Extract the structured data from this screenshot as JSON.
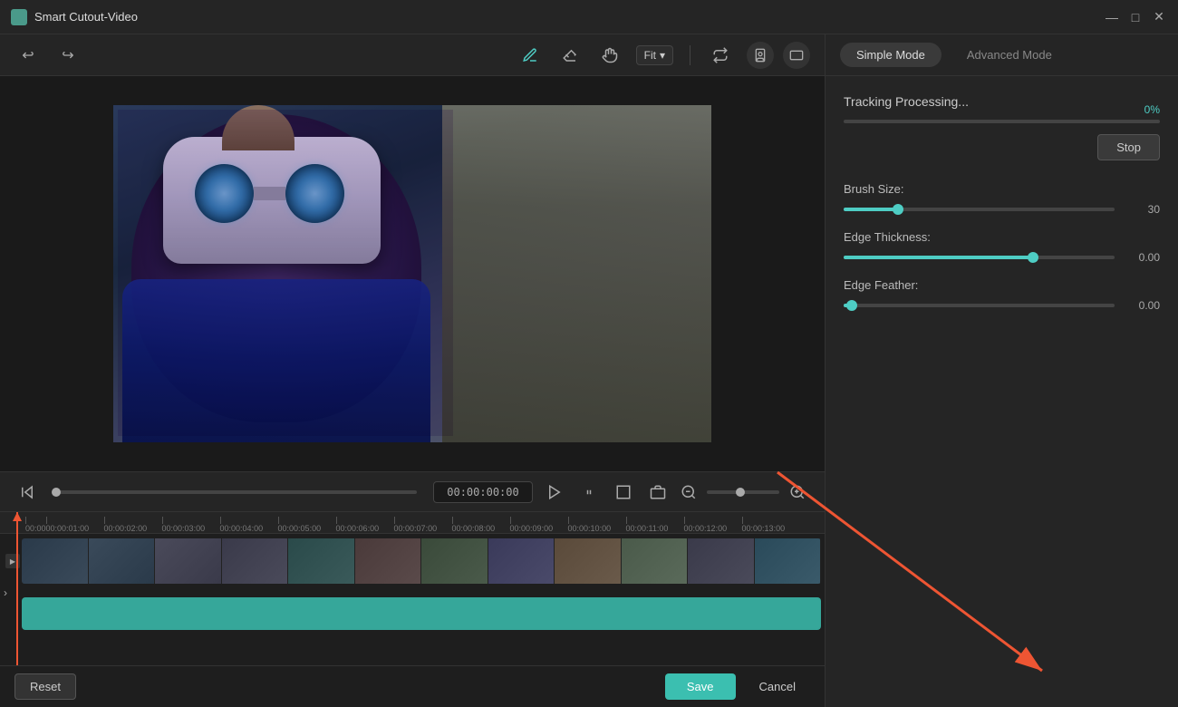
{
  "app": {
    "title": "Smart Cutout-Video"
  },
  "window_controls": {
    "minimize": "—",
    "maximize": "□",
    "close": "✕"
  },
  "toolbar": {
    "undo_label": "↩",
    "redo_label": "↪",
    "draw_label": "✏",
    "erase_label": "◯",
    "hand_label": "✋",
    "fit_label": "Fit",
    "fit_dropdown": "▾",
    "swap_label": "⇄",
    "portrait_icon": "👤",
    "landscape_icon": "⬚"
  },
  "playback": {
    "time": "00:00:00:00",
    "prev_frame": "⏮",
    "play": "▶",
    "pause": "⏸",
    "stop_square": "⏹"
  },
  "timeline": {
    "ruler_marks": [
      "00:00",
      "00:00:01:00",
      "00:00:02:00",
      "00:00:03:00",
      "00:00:04:00",
      "00:00:05:00",
      "00:00:06:00",
      "00:00:07:00",
      "00:00:08:00",
      "00:00:09:00",
      "00:00:10:00",
      "00:00:11:00",
      "00:00:12:00",
      "00:00:13:00"
    ]
  },
  "right_panel": {
    "mode_tabs": [
      "Simple Mode",
      "Advanced Mode"
    ],
    "active_tab": "Simple Mode",
    "tracking_title": "Tracking Processing...",
    "progress_percent": "0%",
    "stop_button": "Stop",
    "brush_size_label": "Brush Size:",
    "brush_size_value": "30",
    "brush_size_percent": 20,
    "edge_thickness_label": "Edge Thickness:",
    "edge_thickness_value": "0.00",
    "edge_thickness_percent": 70,
    "edge_feather_label": "Edge Feather:",
    "edge_feather_value": "0.00",
    "edge_feather_percent": 3
  },
  "bottom_bar": {
    "reset_label": "Reset",
    "save_label": "Save",
    "cancel_label": "Cancel"
  }
}
